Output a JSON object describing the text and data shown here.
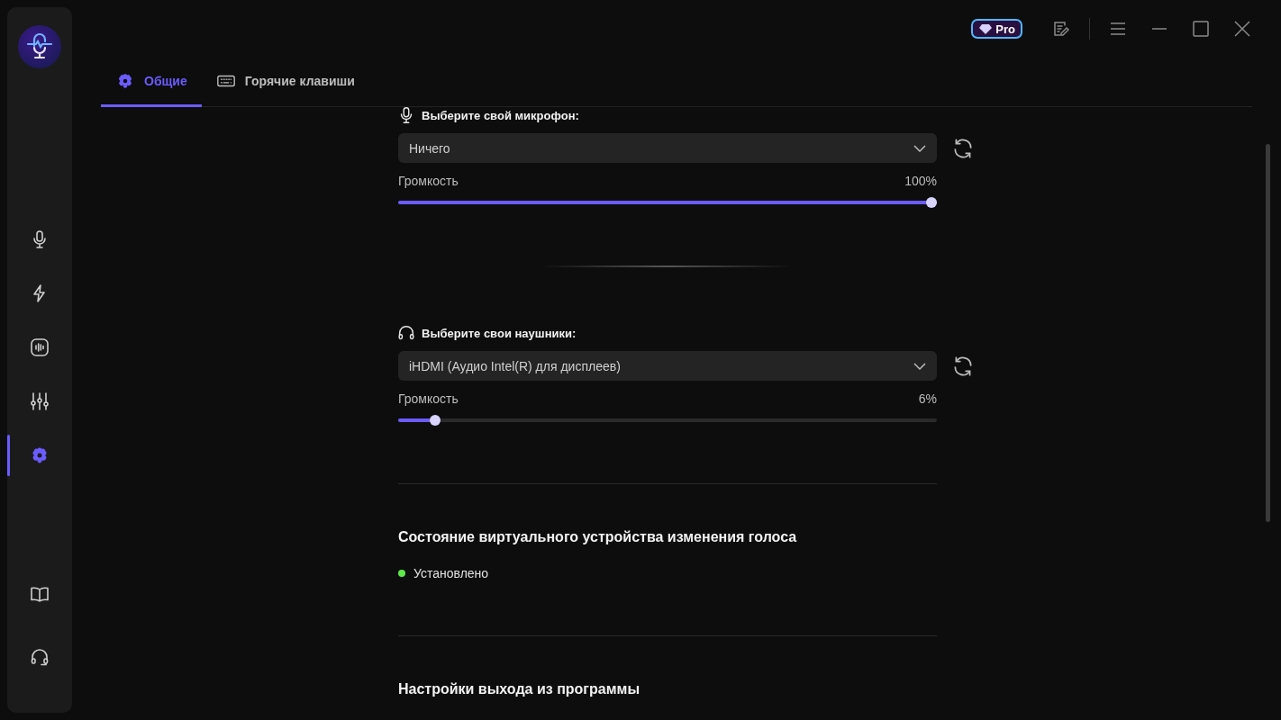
{
  "sidebar": {
    "nav": [
      {
        "kind": "mic",
        "selected": false
      },
      {
        "kind": "bolt",
        "selected": false
      },
      {
        "kind": "wave",
        "selected": false
      },
      {
        "kind": "sliders",
        "selected": false
      },
      {
        "kind": "settings",
        "selected": true
      }
    ],
    "bottom": [
      {
        "kind": "book"
      },
      {
        "kind": "headset"
      }
    ]
  },
  "titlebar": {
    "pro_badge": "Pro"
  },
  "tabs": [
    {
      "label": "Общие",
      "kind": "settings",
      "selected": true
    },
    {
      "label": "Горячие клавиши",
      "kind": "keyboard",
      "selected": false
    }
  ],
  "devices": [
    {
      "kind": "mic",
      "title": "Выберите свой микрофон:",
      "device": "Ничего",
      "volume_label": "Громкость",
      "reading": "100%",
      "level": 1
    },
    {
      "kind": "headphones",
      "title": "Выберите свои наушники:",
      "device": "iHDMI (Аудио Intel(R) для дисплеев)",
      "volume_label": "Громкость",
      "reading": "6%",
      "level": 0.06
    }
  ],
  "virtual_device": {
    "title": "Состояние виртуального устройства изменения голоса",
    "status": {
      "label": "Установлено",
      "color": "#5fe84a"
    }
  },
  "exit_settings": {
    "title": "Настройки выхода из программы"
  }
}
